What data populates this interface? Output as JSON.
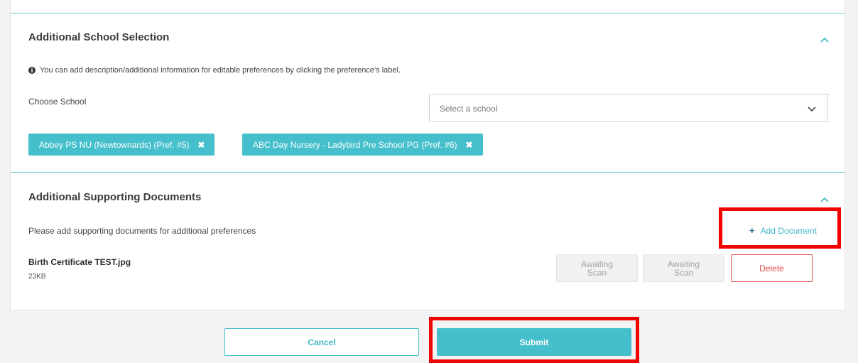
{
  "school_section": {
    "title": "Additional School Selection",
    "info": "You can add description/additional information for editable preferences by clicking the preference's label.",
    "info_icon": "info-icon",
    "choose_label": "Choose School",
    "select_placeholder": "Select a school",
    "chips": [
      {
        "label": "Abbey PS NU (Newtownards) (Pref. #5)",
        "remove": "✖"
      },
      {
        "label": "ABC Day Nursery - Ladybird Pre School PG (Pref. #6)",
        "remove": "✖"
      }
    ]
  },
  "docs_section": {
    "title": "Additional Supporting Documents",
    "description": "Please add supporting documents for additional preferences",
    "add_plus": "+",
    "add_label": "Add Document",
    "file": {
      "name": "Birth Certificate TEST.jpg",
      "size": "23KB",
      "status_1_line1": "Awaiting",
      "status_1_line2": "Scan",
      "status_2_line1": "Awaiting",
      "status_2_line2": "Scan",
      "delete_label": "Delete"
    }
  },
  "footer": {
    "cancel_label": "Cancel",
    "submit_label": "Submit"
  },
  "colors": {
    "accent": "#45bfcc",
    "danger": "#e24a4a",
    "highlight": "#f20000"
  }
}
